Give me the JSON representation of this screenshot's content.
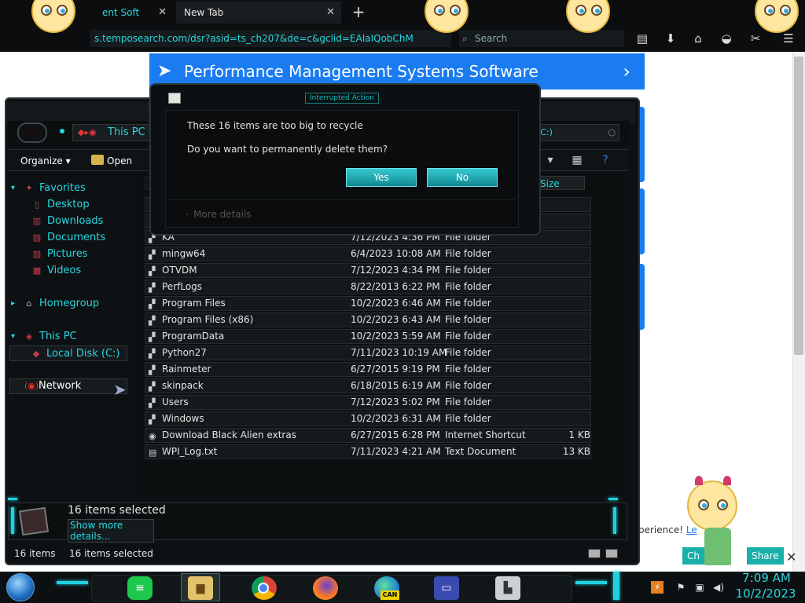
{
  "browser": {
    "tabs": [
      {
        "label": "ent Soft",
        "active": false
      },
      {
        "label": "New Tab",
        "active": true
      }
    ],
    "close_glyph": "✕",
    "new_tab_glyph": "+",
    "url": "s.temposearch.com/dsr?asid=ts_ch207&de=c&gclid=EAIaIQobChM",
    "search_placeholder": "Search",
    "toolbar_icons": [
      "reading-list-icon",
      "download-icon",
      "home-icon",
      "pocket-icon",
      "extension-icon",
      "menu-icon"
    ]
  },
  "webpage": {
    "ad_title": "Performance Management Systems Software",
    "cookie_text": "perience! ",
    "cookie_link": "Le",
    "buttons": [
      "Ch",
      "Share"
    ],
    "close_glyph": "✕"
  },
  "explorer": {
    "breadcrumb": "This PC",
    "breadcrumb_right": "(C:)",
    "toolbar": {
      "organize": "Organize ▾",
      "open": "Open"
    },
    "nav": {
      "favorites": "Favorites",
      "favorites_items": [
        "Desktop",
        "Downloads",
        "Documents",
        "Pictures",
        "Videos"
      ],
      "homegroup": "Homegroup",
      "this_pc": "This PC",
      "local_disk": "Local Disk (C:)",
      "network": "Network"
    },
    "columns": {
      "size": "Size"
    },
    "files": [
      {
        "name": "KA",
        "date": "7/12/2023 4:36 PM",
        "type": "File folder",
        "size": ""
      },
      {
        "name": "mingw64",
        "date": "6/4/2023 10:08 AM",
        "type": "File folder",
        "size": ""
      },
      {
        "name": "OTVDM",
        "date": "7/12/2023 4:34 PM",
        "type": "File folder",
        "size": ""
      },
      {
        "name": "PerfLogs",
        "date": "8/22/2013 6:22 PM",
        "type": "File folder",
        "size": ""
      },
      {
        "name": "Program Files",
        "date": "10/2/2023 6:46 AM",
        "type": "File folder",
        "size": ""
      },
      {
        "name": "Program Files (x86)",
        "date": "10/2/2023 6:43 AM",
        "type": "File folder",
        "size": ""
      },
      {
        "name": "ProgramData",
        "date": "10/2/2023 5:59 AM",
        "type": "File folder",
        "size": ""
      },
      {
        "name": "Python27",
        "date": "7/11/2023 10:19 AM",
        "type": "File folder",
        "size": ""
      },
      {
        "name": "Rainmeter",
        "date": "6/27/2015 9:19 PM",
        "type": "File folder",
        "size": ""
      },
      {
        "name": "skinpack",
        "date": "6/18/2015 6:19 AM",
        "type": "File folder",
        "size": ""
      },
      {
        "name": "Users",
        "date": "7/12/2023 5:02 PM",
        "type": "File folder",
        "size": ""
      },
      {
        "name": "Windows",
        "date": "10/2/2023 6:31 AM",
        "type": "File folder",
        "size": ""
      },
      {
        "name": "Download Black Alien extras",
        "date": "6/27/2015 6:28 PM",
        "type": "Internet Shortcut",
        "size": "1 KB"
      },
      {
        "name": "WPI_Log.txt",
        "date": "7/11/2023 4:21 AM",
        "type": "Text Document",
        "size": "13 KB"
      }
    ],
    "details": {
      "title": "16 items selected",
      "link": "Show more details..."
    },
    "status": {
      "count": "16 items",
      "selected": "16 items selected"
    }
  },
  "dialog": {
    "title": "Interrupted Action",
    "message1": "These 16 items are too big to recycle",
    "message2": "Do you want to permanently delete them?",
    "yes": "Yes",
    "no": "No",
    "more_details": "More details"
  },
  "taskbar": {
    "apps": [
      "notes-app-icon",
      "file-explorer-icon",
      "chrome-icon",
      "firefox-icon",
      "edge-icon",
      "control-panel-icon",
      "monitor-icon"
    ],
    "edge_badge": "CAN",
    "time": "7:09 AM",
    "date": "10/2/2023"
  },
  "colors": {
    "accent": "#28d7e0",
    "ad_blue": "#1b7cf2",
    "button_teal": "#18b0a8",
    "folder_red": "#c83a4a"
  }
}
